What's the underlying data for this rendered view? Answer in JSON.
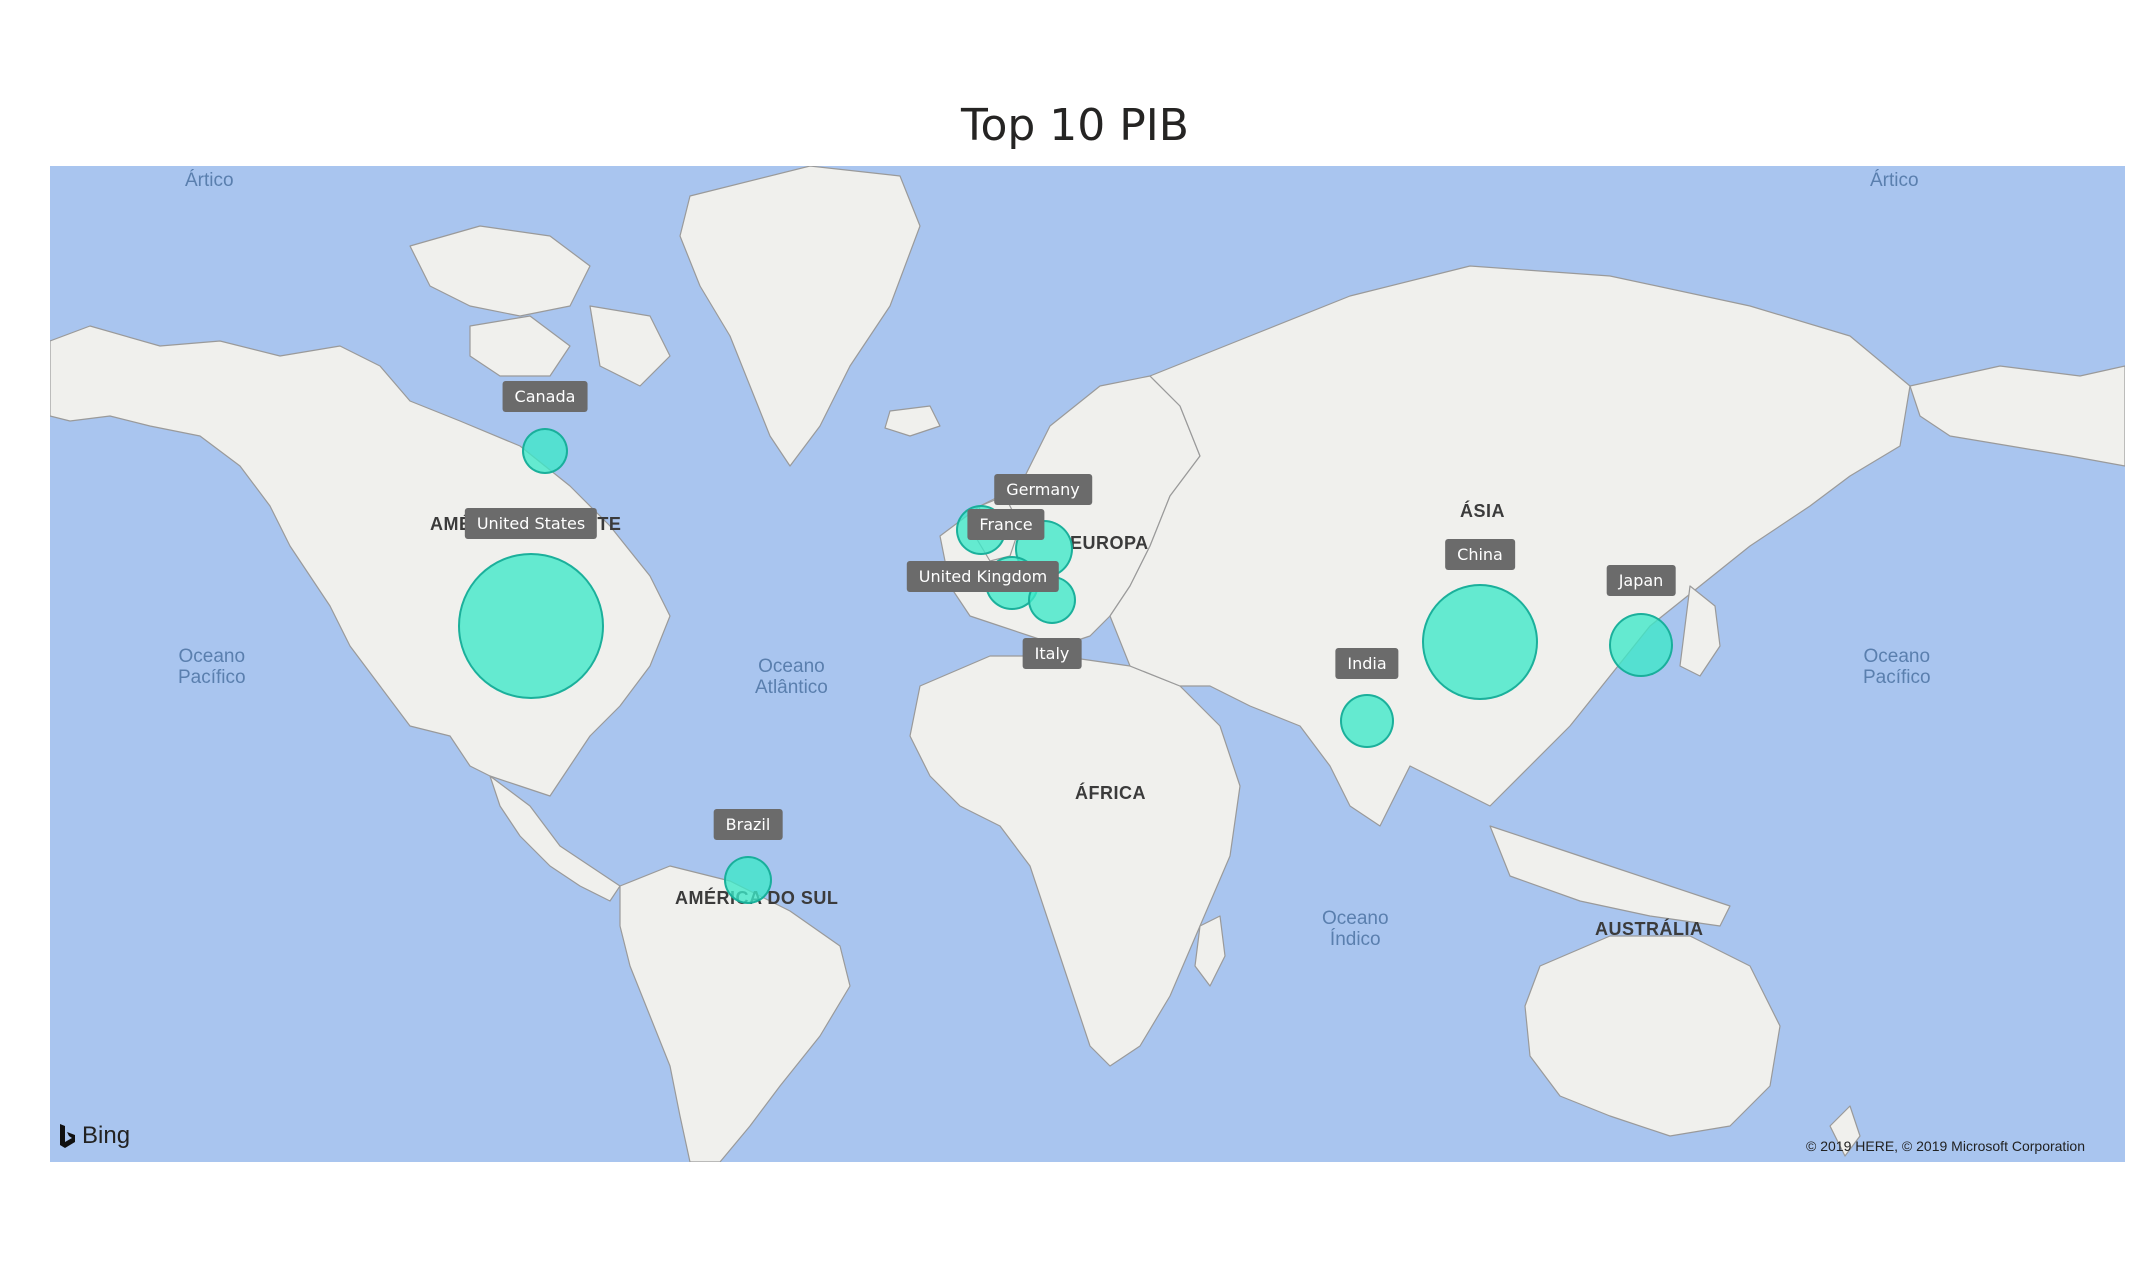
{
  "title": "Top 10 PIB",
  "map": {
    "provider": "Bing",
    "copyright": "© 2019 HERE, © 2019 Microsoft Corporation",
    "colors": {
      "water": "#a9c5ef",
      "land": "#f0f0ed",
      "bubble": "#3ce8c8",
      "tag": "#6b6b6b"
    },
    "continents": [
      "AMÉRICA DO NORTE",
      "AMÉRICA DO SUL",
      "EUROPA",
      "ÁFRICA",
      "ÁSIA",
      "AUSTRÁLIA"
    ],
    "oceans": [
      [
        "Ártico"
      ],
      [
        "Ártico"
      ],
      [
        "Oceano",
        "Pacífico"
      ],
      [
        "Oceano",
        "Atlântico"
      ],
      [
        "Oceano",
        "Índico"
      ],
      [
        "Oceano",
        "Pacífico"
      ]
    ],
    "countries": [
      {
        "name": "United States"
      },
      {
        "name": "China"
      },
      {
        "name": "Japan"
      },
      {
        "name": "Germany"
      },
      {
        "name": "United Kingdom"
      },
      {
        "name": "France"
      },
      {
        "name": "India"
      },
      {
        "name": "Italy"
      },
      {
        "name": "Brazil"
      },
      {
        "name": "Canada"
      }
    ]
  }
}
